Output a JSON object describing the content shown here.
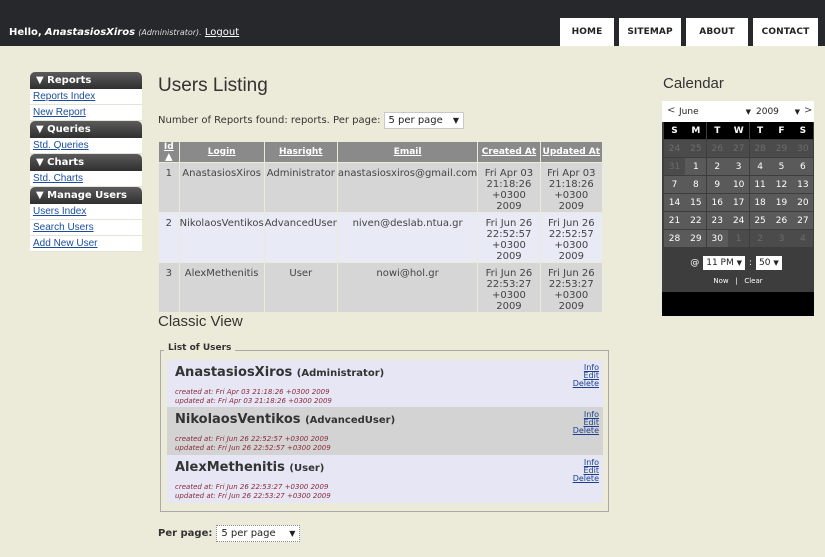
{
  "header": {
    "hello": "Hello,",
    "username": "AnastasiosXiros",
    "role_text": "(Administrator).",
    "logout_label": "Logout",
    "nav": [
      "HOME",
      "SITEMAP",
      "ABOUT",
      "CONTACT"
    ]
  },
  "sidebar": {
    "sections": [
      {
        "title": "▼ Reports",
        "links": [
          "Reports Index",
          "New Report"
        ]
      },
      {
        "title": "▼ Queries",
        "links": [
          "Std. Queries"
        ]
      },
      {
        "title": "▼ Charts",
        "links": [
          "Std. Charts"
        ]
      },
      {
        "title": "▼ Manage Users",
        "links": [
          "Users Index",
          "Search Users",
          "Add New User"
        ]
      }
    ]
  },
  "main": {
    "title": "Users Listing",
    "count_text": "Number of Reports found: reports. Per page:",
    "per_page_value": "5 per page",
    "columns": [
      "Id ▲",
      "Login",
      "Hasright",
      "Email",
      "Created At",
      "Updated At"
    ],
    "rows": [
      {
        "id": "1",
        "login": "AnastasiosXiros",
        "right": "Administrator",
        "email": "anastasiosxiros@gmail.com",
        "created": [
          "Fri Apr 03",
          "21:18:26",
          "+0300 2009"
        ],
        "updated": [
          "Fri Apr 03",
          "21:18:26",
          "+0300 2009"
        ]
      },
      {
        "id": "2",
        "login": "NikolaosVentikos",
        "right": "AdvancedUser",
        "email": "niven@deslab.ntua.gr",
        "created": [
          "Fri Jun 26",
          "22:52:57",
          "+0300 2009"
        ],
        "updated": [
          "Fri Jun 26",
          "22:52:57",
          "+0300 2009"
        ]
      },
      {
        "id": "3",
        "login": "AlexMethenitis",
        "right": "User",
        "email": "nowi@hol.gr",
        "created": [
          "Fri Jun 26",
          "22:53:27",
          "+0300 2009"
        ],
        "updated": [
          "Fri Jun 26",
          "22:53:27",
          "+0300 2009"
        ]
      }
    ],
    "classic_title": "Classic View",
    "classic_legend": "List of Users",
    "cards": [
      {
        "name": "AnastasiosXiros",
        "role": "(Administrator)",
        "created": "created at: Fri Apr 03 21:18:26 +0300 2009",
        "updated": "updated at: Fri Apr 03 21:18:26 +0300 2009"
      },
      {
        "name": "NikolaosVentikos",
        "role": "(AdvancedUser)",
        "created": "created at: Fri Jun 26 22:52:57 +0300 2009",
        "updated": "updated at: Fri Jun 26 22:52:57 +0300 2009"
      },
      {
        "name": "AlexMethenitis",
        "role": "(User)",
        "created": "created at: Fri Jun 26 22:53:27 +0300 2009",
        "updated": "updated at: Fri Jun 26 22:53:27 +0300 2009"
      }
    ],
    "card_actions": [
      "Info",
      "Edit",
      "Delete"
    ],
    "per_page_label": "Per page:",
    "per_page_bottom": "5 per page"
  },
  "calendar": {
    "title": "Calendar",
    "prev": "<",
    "next": ">",
    "month": "June",
    "year": "2009",
    "dow": [
      "S",
      "M",
      "T",
      "W",
      "T",
      "F",
      "S"
    ],
    "weeks": [
      [
        {
          "d": "24",
          "o": true
        },
        {
          "d": "25",
          "o": true
        },
        {
          "d": "26",
          "o": true
        },
        {
          "d": "27",
          "o": true
        },
        {
          "d": "28",
          "o": true
        },
        {
          "d": "29",
          "o": true
        },
        {
          "d": "30",
          "o": true
        }
      ],
      [
        {
          "d": "31",
          "o": true
        },
        {
          "d": "1"
        },
        {
          "d": "2"
        },
        {
          "d": "3"
        },
        {
          "d": "4"
        },
        {
          "d": "5"
        },
        {
          "d": "6"
        }
      ],
      [
        {
          "d": "7"
        },
        {
          "d": "8"
        },
        {
          "d": "9"
        },
        {
          "d": "10"
        },
        {
          "d": "11"
        },
        {
          "d": "12"
        },
        {
          "d": "13"
        }
      ],
      [
        {
          "d": "14"
        },
        {
          "d": "15"
        },
        {
          "d": "16"
        },
        {
          "d": "17"
        },
        {
          "d": "18"
        },
        {
          "d": "19"
        },
        {
          "d": "20"
        }
      ],
      [
        {
          "d": "21"
        },
        {
          "d": "22"
        },
        {
          "d": "23"
        },
        {
          "d": "24"
        },
        {
          "d": "25"
        },
        {
          "d": "26"
        },
        {
          "d": "27"
        }
      ],
      [
        {
          "d": "28"
        },
        {
          "d": "29"
        },
        {
          "d": "30"
        },
        {
          "d": "1",
          "o": true
        },
        {
          "d": "2",
          "o": true
        },
        {
          "d": "3",
          "o": true
        },
        {
          "d": "4",
          "o": true
        }
      ]
    ],
    "time_at": "@",
    "hour": "11 PM",
    "sep": ":",
    "minute": "50",
    "now": "Now",
    "bar": "|",
    "clear": "Clear"
  },
  "colors": {
    "background": "#ecebd9",
    "topbar": "#27282b",
    "link": "#1a4d9e",
    "meta": "#8b2b3a"
  }
}
